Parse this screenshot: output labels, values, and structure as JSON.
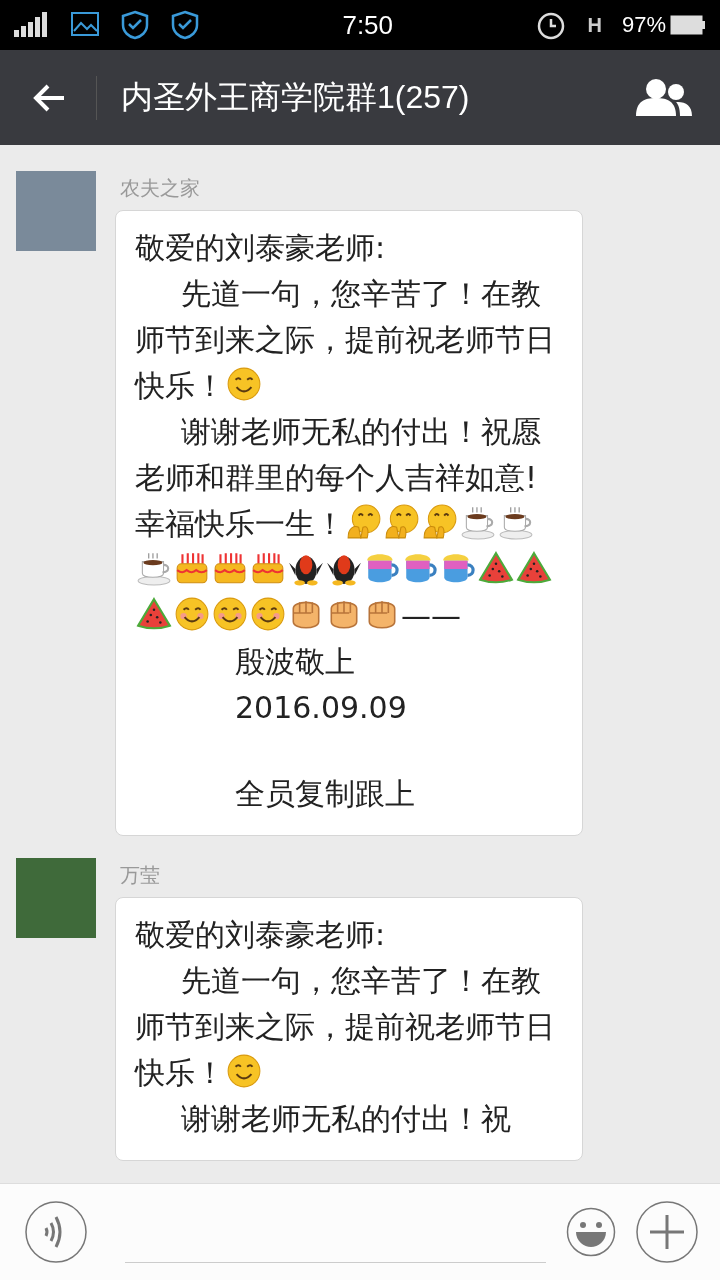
{
  "status_bar": {
    "time": "7:50",
    "network": "H",
    "battery": "97%"
  },
  "header": {
    "title": "内圣外王商学院群1(257)"
  },
  "messages": [
    {
      "sender": "农夫之家",
      "paragraphs": [
        {
          "kind": "plain",
          "parts": [
            {
              "kind": "text",
              "text": "敬爱的刘泰豪老师:"
            }
          ]
        },
        {
          "kind": "indent",
          "parts": [
            {
              "kind": "text",
              "text": "先道一句，您辛苦了！在教师节到来之际，提前祝老师节日快乐！"
            },
            {
              "kind": "smile"
            }
          ]
        },
        {
          "kind": "indent",
          "parts": [
            {
              "kind": "text",
              "text": "谢谢老师无私的付出！祝愿老师和群里的每个人吉祥如意!幸福快乐一生！"
            },
            {
              "kind": "hug"
            },
            {
              "kind": "hug"
            },
            {
              "kind": "hug"
            },
            {
              "kind": "coffee"
            },
            {
              "kind": "coffee"
            },
            {
              "kind": "coffee"
            },
            {
              "kind": "cake"
            },
            {
              "kind": "cake"
            },
            {
              "kind": "cake"
            },
            {
              "kind": "penguin"
            },
            {
              "kind": "penguin"
            },
            {
              "kind": "cup"
            },
            {
              "kind": "cup"
            },
            {
              "kind": "cup"
            },
            {
              "kind": "watermelon"
            },
            {
              "kind": "watermelon"
            },
            {
              "kind": "watermelon"
            },
            {
              "kind": "grin"
            },
            {
              "kind": "grin"
            },
            {
              "kind": "grin"
            },
            {
              "kind": "fist"
            },
            {
              "kind": "fist"
            },
            {
              "kind": "fist"
            },
            {
              "kind": "text",
              "text": "——"
            }
          ]
        },
        {
          "kind": "sign",
          "parts": [
            {
              "kind": "text",
              "text": "殷波敬上"
            }
          ]
        },
        {
          "kind": "sign",
          "parts": [
            {
              "kind": "text",
              "text": "2016.09.09"
            }
          ]
        },
        {
          "kind": "gap"
        },
        {
          "kind": "sign",
          "parts": [
            {
              "kind": "text",
              "text": "全员复制跟上"
            }
          ]
        }
      ]
    },
    {
      "sender": "万莹",
      "paragraphs": [
        {
          "kind": "plain",
          "parts": [
            {
              "kind": "text",
              "text": "敬爱的刘泰豪老师:"
            }
          ]
        },
        {
          "kind": "indent",
          "parts": [
            {
              "kind": "text",
              "text": "先道一句，您辛苦了！在教师节到来之际，提前祝老师节日快乐！"
            },
            {
              "kind": "smile"
            }
          ]
        },
        {
          "kind": "indent",
          "parts": [
            {
              "kind": "text",
              "text": "谢谢老师无私的付出！祝"
            }
          ]
        }
      ]
    }
  ]
}
